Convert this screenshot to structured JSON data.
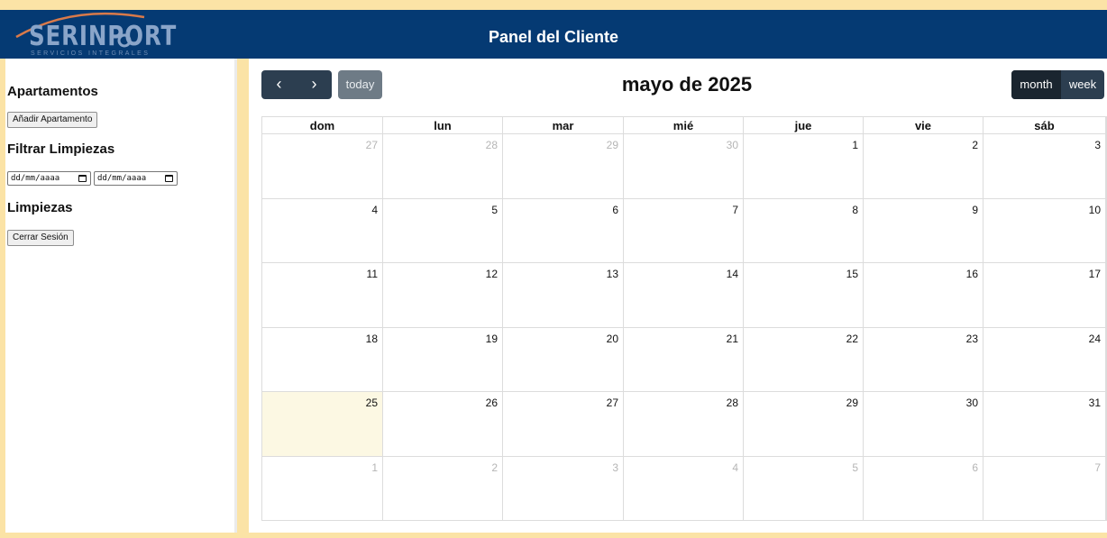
{
  "header": {
    "logo_text": "SERINPORT",
    "logo_subtext": "SERVICIOS INTEGRALES",
    "title": "Panel del Cliente"
  },
  "sidebar": {
    "apartments_heading": "Apartamentos",
    "add_apartment_label": "Añadir Apartamento",
    "filter_heading": "Filtrar Limpiezas",
    "date_from_placeholder": "dd/mm/aaaa",
    "date_to_placeholder": "dd/mm/aaaa",
    "cleanings_heading": "Limpiezas",
    "logout_label": "Cerrar Sesión"
  },
  "calendar": {
    "prev_label": "‹",
    "next_label": "›",
    "today_label": "today",
    "title": "mayo de 2025",
    "views": [
      {
        "label": "month",
        "active": true
      },
      {
        "label": "week",
        "active": false
      }
    ],
    "weekdays": [
      "dom",
      "lun",
      "mar",
      "mié",
      "jue",
      "vie",
      "sáb"
    ],
    "weeks": [
      [
        {
          "d": "27",
          "o": true
        },
        {
          "d": "28",
          "o": true
        },
        {
          "d": "29",
          "o": true
        },
        {
          "d": "30",
          "o": true
        },
        {
          "d": "1"
        },
        {
          "d": "2"
        },
        {
          "d": "3"
        }
      ],
      [
        {
          "d": "4"
        },
        {
          "d": "5"
        },
        {
          "d": "6"
        },
        {
          "d": "7"
        },
        {
          "d": "8"
        },
        {
          "d": "9"
        },
        {
          "d": "10"
        }
      ],
      [
        {
          "d": "11"
        },
        {
          "d": "12"
        },
        {
          "d": "13"
        },
        {
          "d": "14"
        },
        {
          "d": "15"
        },
        {
          "d": "16"
        },
        {
          "d": "17"
        }
      ],
      [
        {
          "d": "18"
        },
        {
          "d": "19"
        },
        {
          "d": "20"
        },
        {
          "d": "21"
        },
        {
          "d": "22"
        },
        {
          "d": "23"
        },
        {
          "d": "24"
        }
      ],
      [
        {
          "d": "25",
          "today": true
        },
        {
          "d": "26"
        },
        {
          "d": "27"
        },
        {
          "d": "28"
        },
        {
          "d": "29"
        },
        {
          "d": "30"
        },
        {
          "d": "31"
        }
      ],
      [
        {
          "d": "1",
          "o": true
        },
        {
          "d": "2",
          "o": true
        },
        {
          "d": "3",
          "o": true
        },
        {
          "d": "4",
          "o": true
        },
        {
          "d": "5",
          "o": true
        },
        {
          "d": "6",
          "o": true
        },
        {
          "d": "7",
          "o": true
        }
      ]
    ]
  },
  "colors": {
    "header_bg": "#053a73",
    "page_bg": "#fbe3a6",
    "button_dark": "#2c3e50",
    "button_active": "#1a252f",
    "today_button": "#6e7b86",
    "today_cell": "#fcf8e3"
  }
}
